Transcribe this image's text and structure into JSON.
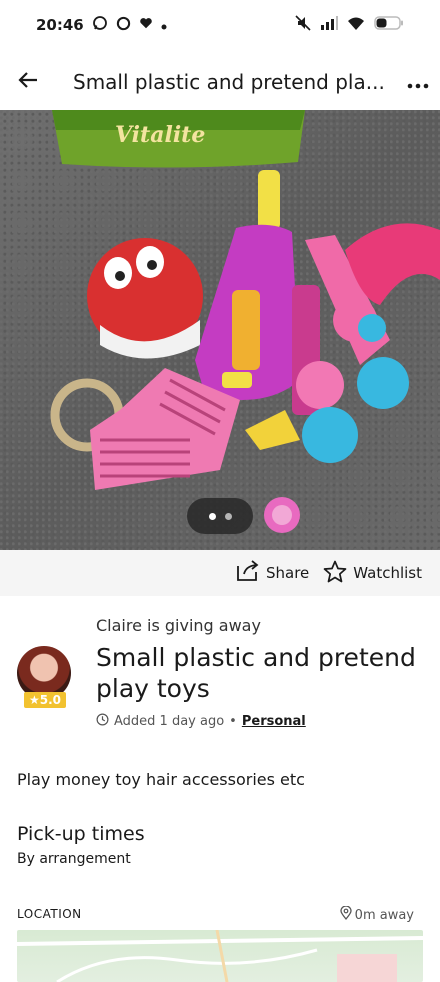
{
  "status_bar": {
    "time": "20:46"
  },
  "header": {
    "title": "Small plastic and pretend pla..."
  },
  "photo": {
    "alt": "",
    "brand_text": "Vitalite",
    "pages": 2,
    "current_page": 1
  },
  "actions": {
    "share_label": "Share",
    "watchlist_label": "Watchlist"
  },
  "listing": {
    "giver_line": "Claire is giving away",
    "title": "Small plastic and pretend play toys",
    "rating": "★5.0",
    "added": "Added 1 day ago",
    "category": "Personal",
    "description": "Play money toy hair accessories etc"
  },
  "pickup": {
    "heading": "Pick-up times",
    "value": "By arrangement"
  },
  "location": {
    "heading": "LOCATION",
    "distance": "0m away"
  },
  "colors": {
    "badge": "#f2c230",
    "share_bar_bg": "#f5f5f5"
  }
}
